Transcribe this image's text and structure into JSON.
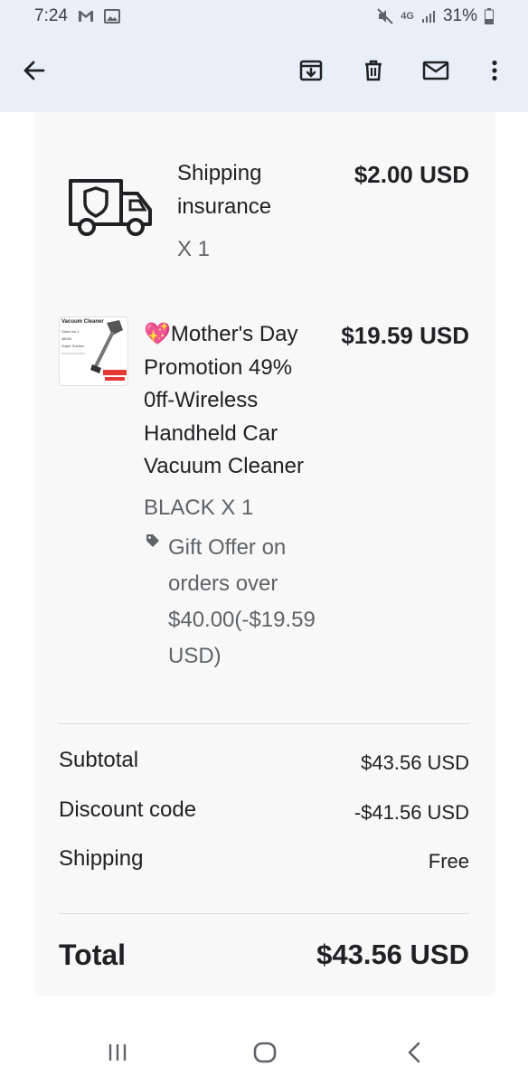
{
  "status_bar": {
    "time": "7:24",
    "network": "4G",
    "battery": "31%"
  },
  "app_bar": {
    "back_icon": "arrow-left-icon",
    "archive_icon": "archive-icon",
    "delete_icon": "trash-icon",
    "mark_unread_icon": "mail-icon",
    "more_icon": "more-vert-icon"
  },
  "order": {
    "items": [
      {
        "name_lines": [
          "Shipping",
          "insurance"
        ],
        "quantity": "X 1",
        "price": "$2.00 USD",
        "icon": "truck-shield-icon"
      },
      {
        "emoji": "💖",
        "name_lines": [
          "Mother's Day",
          "Promotion 49%",
          "0ff-Wireless",
          "Handheld Car",
          "Vacuum Cleaner"
        ],
        "variant": "BLACK X 1",
        "discount_icon": "tag-icon",
        "discount_lines": [
          "Gift Offer on",
          "orders over",
          "$40.00(-$19.59",
          "USD)"
        ],
        "price": "$19.59 USD",
        "thumbnail": {
          "title": "Vacuum Cleaner",
          "lines": [
            "Sales No.1",
            "38000",
            "Super Suction"
          ]
        }
      }
    ],
    "summary": {
      "subtotal_label": "Subtotal",
      "subtotal_value": "$43.56 USD",
      "discount_label": "Discount code",
      "discount_value": "-$41.56 USD",
      "shipping_label": "Shipping",
      "shipping_value": "Free"
    },
    "total": {
      "label": "Total",
      "value": "$43.56 USD"
    }
  },
  "nav_bar": {
    "recents_icon": "recents-icon",
    "home_icon": "home-icon",
    "back_icon": "back-chevron-icon"
  }
}
